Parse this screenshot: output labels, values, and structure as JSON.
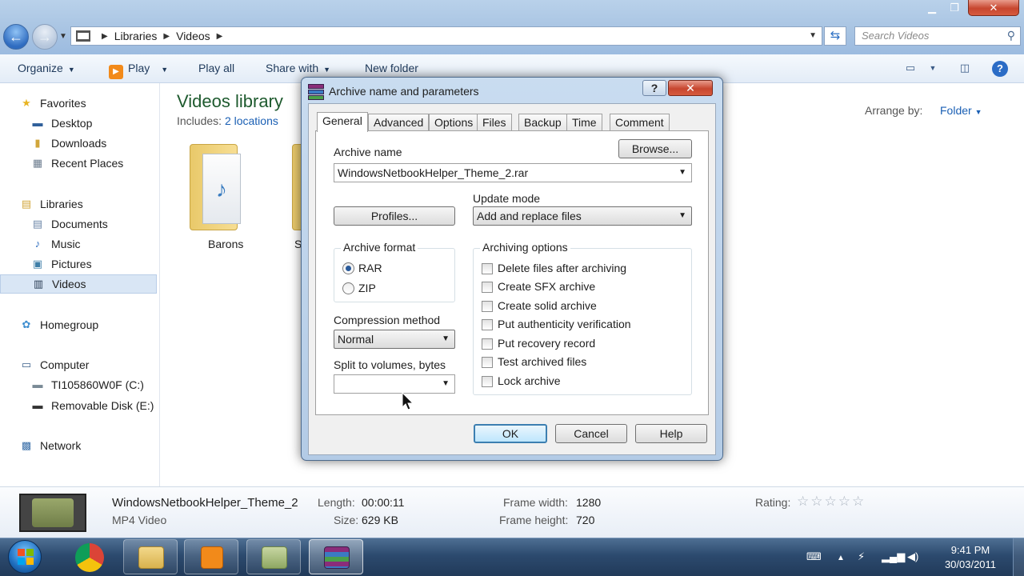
{
  "explorer": {
    "breadcrumb": [
      "Libraries",
      "Videos"
    ],
    "search_placeholder": "Search Videos",
    "toolbar": {
      "organize": "Organize",
      "play": "Play",
      "play_all": "Play all",
      "share_with": "Share with",
      "new_folder": "New folder"
    },
    "nav": {
      "favorites": "Favorites",
      "desktop": "Desktop",
      "downloads": "Downloads",
      "recent_places": "Recent Places",
      "libraries": "Libraries",
      "documents": "Documents",
      "music": "Music",
      "pictures": "Pictures",
      "videos": "Videos",
      "homegroup": "Homegroup",
      "computer": "Computer",
      "drive_c": "TI105860W0F (C:)",
      "drive_e": "Removable Disk (E:)",
      "network": "Network"
    },
    "library": {
      "title": "Videos library",
      "includes_label": "Includes:",
      "includes_link": "2 locations",
      "arrange_label": "Arrange by:",
      "arrange_value": "Folder"
    },
    "folders": [
      "Barons",
      "S"
    ],
    "details": {
      "file_name": "WindowsNetbookHelper_Theme_2",
      "file_type": "MP4 Video",
      "length_label": "Length:",
      "length_value": "00:00:11",
      "size_label": "Size:",
      "size_value": "629 KB",
      "frame_width_label": "Frame width:",
      "frame_width_value": "1280",
      "frame_height_label": "Frame height:",
      "frame_height_value": "720",
      "rating_label": "Rating:",
      "rating_stars": "☆☆☆☆☆"
    }
  },
  "dialog": {
    "title": "Archive name and parameters",
    "tabs": [
      "General",
      "Advanced",
      "Options",
      "Files",
      "Backup",
      "Time",
      "Comment"
    ],
    "archive_name_label": "Archive name",
    "archive_name_value": "WindowsNetbookHelper_Theme_2.rar",
    "browse_button": "Browse...",
    "update_mode_label": "Update mode",
    "update_mode_value": "Add and replace files",
    "profiles_button": "Profiles...",
    "archive_format_label": "Archive format",
    "format_rar": "RAR",
    "format_zip": "ZIP",
    "compression_method_label": "Compression method",
    "compression_method_value": "Normal",
    "split_label": "Split to volumes, bytes",
    "split_value": "",
    "archiving_options_label": "Archiving options",
    "options": [
      "Delete files after archiving",
      "Create SFX archive",
      "Create solid archive",
      "Put authenticity verification",
      "Put recovery record",
      "Test archived files",
      "Lock archive"
    ],
    "ok_button": "OK",
    "cancel_button": "Cancel",
    "help_button": "Help"
  },
  "taskbar": {
    "time": "9:41 PM",
    "date": "30/03/2011"
  },
  "icons": {
    "back": "back-arrow-icon",
    "forward": "forward-arrow-icon",
    "search": "search-icon",
    "help": "help-icon"
  }
}
